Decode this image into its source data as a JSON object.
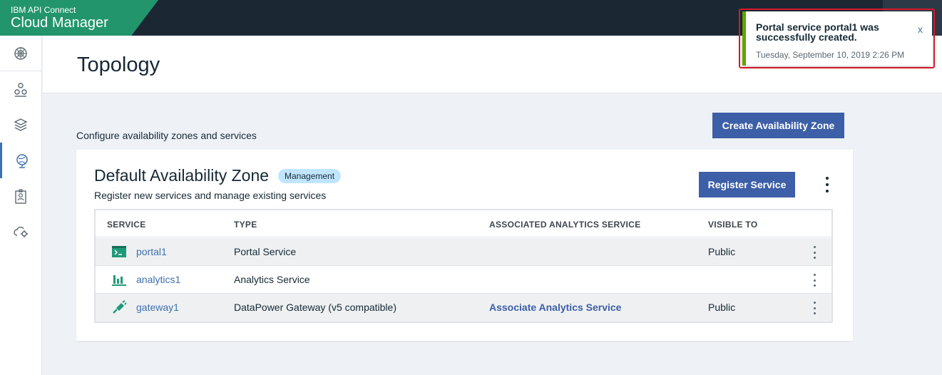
{
  "brand": {
    "small": "IBM API Connect",
    "big": "Cloud Manager"
  },
  "page": {
    "title": "Topology",
    "subtitle": "Configure availability zones and services",
    "create_zone_label": "Create Availability Zone"
  },
  "zone": {
    "title": "Default Availability Zone",
    "tag": "Management",
    "description": "Register new services and manage existing services",
    "register_label": "Register Service",
    "columns": [
      "SERVICE",
      "TYPE",
      "ASSOCIATED ANALYTICS SERVICE",
      "VISIBLE TO"
    ],
    "rows": [
      {
        "name": "portal1",
        "type": "Portal Service",
        "analytics": "",
        "visible": "Public",
        "icon": "portal-icon"
      },
      {
        "name": "analytics1",
        "type": "Analytics Service",
        "analytics": "",
        "visible": "",
        "icon": "analytics-icon"
      },
      {
        "name": "gateway1",
        "type": "DataPower Gateway (v5 compatible)",
        "analytics": "Associate Analytics Service",
        "visible": "Public",
        "icon": "gateway-icon"
      }
    ]
  },
  "toast": {
    "title": "Portal service portal1 was successfully created.",
    "timestamp": "Tuesday, September 10, 2019 2:26 PM",
    "close": "x"
  },
  "sidebar": [
    "dashboard-icon",
    "provider-orgs-icon",
    "resources-icon",
    "topology-icon",
    "members-icon",
    "settings-icon"
  ],
  "colors": {
    "accent": "#3d5fa7",
    "brand": "#22956d",
    "success": "#5aa700",
    "service_icon": "#1f9a79"
  }
}
